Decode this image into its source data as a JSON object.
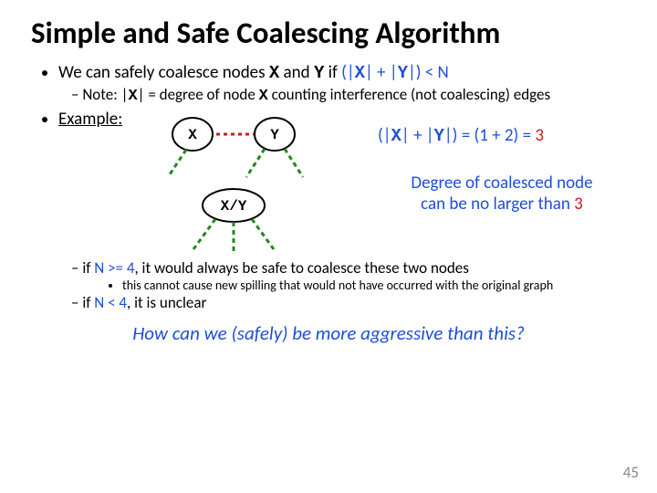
{
  "title": "Simple and Safe Coalescing Algorithm",
  "b1": {
    "pre": "We can safely coalesce nodes ",
    "x": "X",
    "mid1": " and ",
    "y": "Y",
    "mid2": " if ",
    "cond_open": "(|",
    "cond_x": "X",
    "cond_plus": "| + |",
    "cond_y": "Y",
    "cond_close": "|) < N"
  },
  "note": {
    "pre": "Note: |",
    "x": "X",
    "mid": "| = degree of node ",
    "x2": "X",
    "post": " counting interference (not coalescing) edges"
  },
  "example_label": "Example:",
  "node_x": "X",
  "node_y": "Y",
  "node_xy": "X/Y",
  "calc": {
    "open": "(|",
    "x": "X",
    "plus": "| + |",
    "y": "Y",
    "close": "|) = (1 + 2) = ",
    "result": "3"
  },
  "deg_line1": "Degree of coalesced node",
  "deg_line2_pre": "can be no larger than ",
  "deg_line2_val": "3",
  "ifge": {
    "pre": "if ",
    "cond": "N >= 4",
    "post": ", it would always be safe to coalesce these two nodes"
  },
  "ifge_sub": "this cannot cause new spilling that would not have occurred with the original graph",
  "iflt": {
    "pre": "if ",
    "cond": "N < 4",
    "post": ", it is unclear"
  },
  "closing": "How can we (safely) be more aggressive than this?",
  "pagenum": "45"
}
